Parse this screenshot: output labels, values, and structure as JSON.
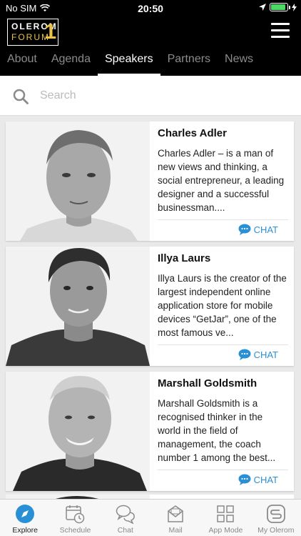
{
  "status": {
    "carrier": "No SIM",
    "time": "20:50",
    "battery_level": 0.9
  },
  "header": {
    "logo_line1": "OLEROM",
    "logo_line2": "FORUM",
    "logo_number": "1",
    "tabs": [
      {
        "label": "About",
        "active": false
      },
      {
        "label": "Agenda",
        "active": false
      },
      {
        "label": "Speakers",
        "active": true
      },
      {
        "label": "Partners",
        "active": false
      },
      {
        "label": "News",
        "active": false
      }
    ]
  },
  "search": {
    "placeholder": "Search",
    "value": ""
  },
  "speakers": [
    {
      "name": "Charles Adler",
      "description": "Charles Adler – is a man of new views and thinking, a social entrepreneur, a leading designer and a successful businessman....",
      "chat_label": "CHAT"
    },
    {
      "name": "Illya Laurs",
      "description": "Illya Laurs is the creator of the largest independent online application store for mobile devices “GetJar”, one of the most famous ve...",
      "chat_label": "CHAT"
    },
    {
      "name": "Marshall Goldsmith",
      "description": "Marshall Goldsmith is a recognised thinker in the world in the field of management, the coach number 1 among the best...",
      "chat_label": "CHAT"
    }
  ],
  "bottom_nav": [
    {
      "label": "Explore",
      "icon": "compass-icon",
      "active": true
    },
    {
      "label": "Schedule",
      "icon": "calendar-clock-icon",
      "active": false
    },
    {
      "label": "Chat",
      "icon": "chat-bubbles-icon",
      "active": false
    },
    {
      "label": "Mail",
      "icon": "mail-icon",
      "active": false
    },
    {
      "label": "App Mode",
      "icon": "grid-icon",
      "active": false
    },
    {
      "label": "My Olerom",
      "icon": "olerom-logo-icon",
      "active": false
    }
  ],
  "colors": {
    "accent": "#2a90d6",
    "header_bg": "#000000",
    "logo_gold": "#e9c24a"
  }
}
